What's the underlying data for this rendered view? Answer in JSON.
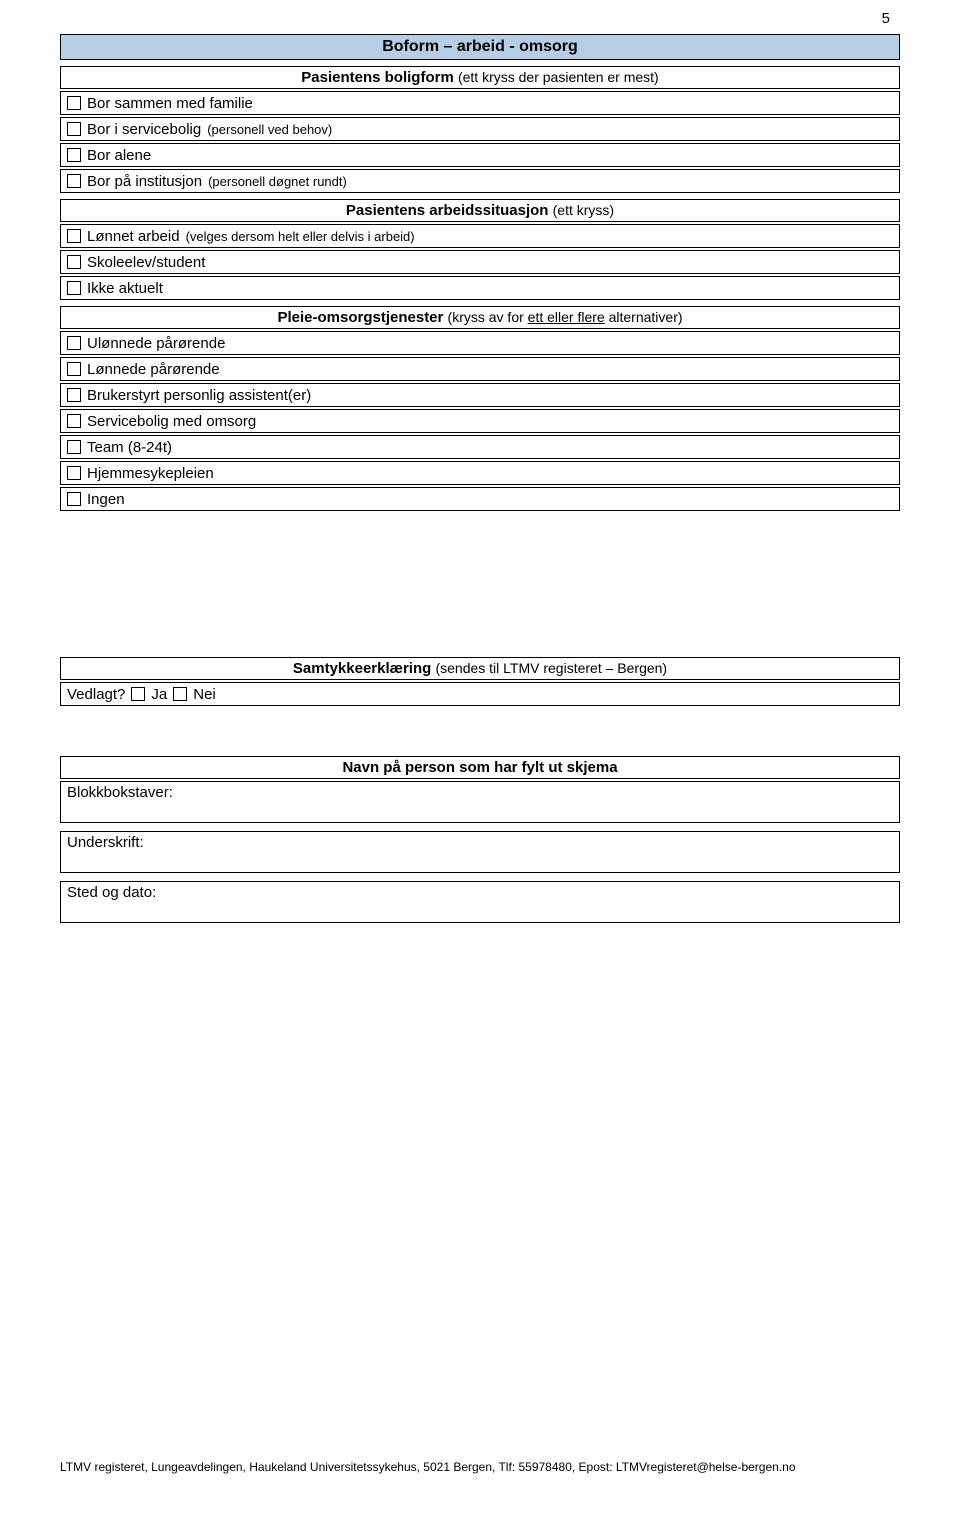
{
  "page_number": "5",
  "section1": {
    "title": "Boform – arbeid - omsorg"
  },
  "group_boligform": {
    "title": "Pasientens boligform",
    "note": "(ett kryss der pasienten er mest)",
    "opts": [
      {
        "label": "Bor sammen med familie",
        "note": ""
      },
      {
        "label": "Bor i servicebolig",
        "note": "(personell ved behov)"
      },
      {
        "label": "Bor alene",
        "note": ""
      },
      {
        "label": "Bor på institusjon",
        "note": "(personell døgnet rundt)"
      }
    ]
  },
  "group_arbeid": {
    "title": "Pasientens arbeidssituasjon",
    "note": "(ett kryss)",
    "opts": [
      {
        "label": "Lønnet arbeid",
        "note": "(velges dersom helt eller delvis i arbeid)"
      },
      {
        "label": "Skoleelev/student",
        "note": ""
      },
      {
        "label": "Ikke aktuelt",
        "note": ""
      }
    ]
  },
  "group_pleie": {
    "title": "Pleie-omsorgstjenester",
    "note_pre": "(kryss av for ",
    "note_underline": "ett eller flere",
    "note_post": " alternativer)",
    "opts": [
      {
        "label": "Ulønnede pårørende"
      },
      {
        "label": "Lønnede pårørende"
      },
      {
        "label": "Brukerstyrt personlig assistent(er)"
      },
      {
        "label": "Servicebolig med omsorg"
      },
      {
        "label": "Team (8-24t)"
      },
      {
        "label": "Hjemmesykepleien"
      },
      {
        "label": "Ingen"
      }
    ]
  },
  "group_consent": {
    "title": "Samtykkeerklæring",
    "note": "(sendes til LTMV registeret – Bergen)",
    "vedlagt": "Vedlagt?",
    "ja": "Ja",
    "nei": "Nei"
  },
  "group_sign": {
    "title": "Navn på person som har fylt ut skjema",
    "blokk": "Blokkbokstaver:",
    "underskrift": "Underskrift:",
    "sted": "Sted og dato:"
  },
  "footer": "LTMV registeret, Lungeavdelingen, Haukeland Universitetssykehus, 5021 Bergen, Tlf: 55978480, Epost: LTMVregisteret@helse-bergen.no"
}
